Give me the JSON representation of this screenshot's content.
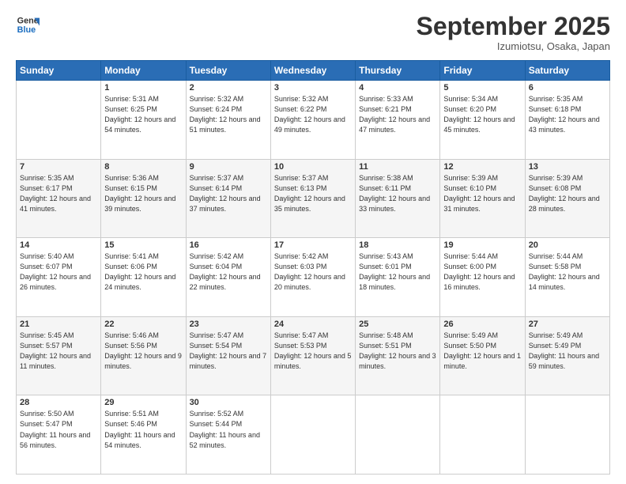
{
  "logo": {
    "line1": "General",
    "line2": "Blue"
  },
  "header": {
    "month": "September 2025",
    "location": "Izumiotsu, Osaka, Japan"
  },
  "weekdays": [
    "Sunday",
    "Monday",
    "Tuesday",
    "Wednesday",
    "Thursday",
    "Friday",
    "Saturday"
  ],
  "weeks": [
    [
      {
        "day": "",
        "sunrise": "",
        "sunset": "",
        "daylight": ""
      },
      {
        "day": "1",
        "sunrise": "5:31 AM",
        "sunset": "6:25 PM",
        "daylight": "12 hours and 54 minutes."
      },
      {
        "day": "2",
        "sunrise": "5:32 AM",
        "sunset": "6:24 PM",
        "daylight": "12 hours and 51 minutes."
      },
      {
        "day": "3",
        "sunrise": "5:32 AM",
        "sunset": "6:22 PM",
        "daylight": "12 hours and 49 minutes."
      },
      {
        "day": "4",
        "sunrise": "5:33 AM",
        "sunset": "6:21 PM",
        "daylight": "12 hours and 47 minutes."
      },
      {
        "day": "5",
        "sunrise": "5:34 AM",
        "sunset": "6:20 PM",
        "daylight": "12 hours and 45 minutes."
      },
      {
        "day": "6",
        "sunrise": "5:35 AM",
        "sunset": "6:18 PM",
        "daylight": "12 hours and 43 minutes."
      }
    ],
    [
      {
        "day": "7",
        "sunrise": "5:35 AM",
        "sunset": "6:17 PM",
        "daylight": "12 hours and 41 minutes."
      },
      {
        "day": "8",
        "sunrise": "5:36 AM",
        "sunset": "6:15 PM",
        "daylight": "12 hours and 39 minutes."
      },
      {
        "day": "9",
        "sunrise": "5:37 AM",
        "sunset": "6:14 PM",
        "daylight": "12 hours and 37 minutes."
      },
      {
        "day": "10",
        "sunrise": "5:37 AM",
        "sunset": "6:13 PM",
        "daylight": "12 hours and 35 minutes."
      },
      {
        "day": "11",
        "sunrise": "5:38 AM",
        "sunset": "6:11 PM",
        "daylight": "12 hours and 33 minutes."
      },
      {
        "day": "12",
        "sunrise": "5:39 AM",
        "sunset": "6:10 PM",
        "daylight": "12 hours and 31 minutes."
      },
      {
        "day": "13",
        "sunrise": "5:39 AM",
        "sunset": "6:08 PM",
        "daylight": "12 hours and 28 minutes."
      }
    ],
    [
      {
        "day": "14",
        "sunrise": "5:40 AM",
        "sunset": "6:07 PM",
        "daylight": "12 hours and 26 minutes."
      },
      {
        "day": "15",
        "sunrise": "5:41 AM",
        "sunset": "6:06 PM",
        "daylight": "12 hours and 24 minutes."
      },
      {
        "day": "16",
        "sunrise": "5:42 AM",
        "sunset": "6:04 PM",
        "daylight": "12 hours and 22 minutes."
      },
      {
        "day": "17",
        "sunrise": "5:42 AM",
        "sunset": "6:03 PM",
        "daylight": "12 hours and 20 minutes."
      },
      {
        "day": "18",
        "sunrise": "5:43 AM",
        "sunset": "6:01 PM",
        "daylight": "12 hours and 18 minutes."
      },
      {
        "day": "19",
        "sunrise": "5:44 AM",
        "sunset": "6:00 PM",
        "daylight": "12 hours and 16 minutes."
      },
      {
        "day": "20",
        "sunrise": "5:44 AM",
        "sunset": "5:58 PM",
        "daylight": "12 hours and 14 minutes."
      }
    ],
    [
      {
        "day": "21",
        "sunrise": "5:45 AM",
        "sunset": "5:57 PM",
        "daylight": "12 hours and 11 minutes."
      },
      {
        "day": "22",
        "sunrise": "5:46 AM",
        "sunset": "5:56 PM",
        "daylight": "12 hours and 9 minutes."
      },
      {
        "day": "23",
        "sunrise": "5:47 AM",
        "sunset": "5:54 PM",
        "daylight": "12 hours and 7 minutes."
      },
      {
        "day": "24",
        "sunrise": "5:47 AM",
        "sunset": "5:53 PM",
        "daylight": "12 hours and 5 minutes."
      },
      {
        "day": "25",
        "sunrise": "5:48 AM",
        "sunset": "5:51 PM",
        "daylight": "12 hours and 3 minutes."
      },
      {
        "day": "26",
        "sunrise": "5:49 AM",
        "sunset": "5:50 PM",
        "daylight": "12 hours and 1 minute."
      },
      {
        "day": "27",
        "sunrise": "5:49 AM",
        "sunset": "5:49 PM",
        "daylight": "11 hours and 59 minutes."
      }
    ],
    [
      {
        "day": "28",
        "sunrise": "5:50 AM",
        "sunset": "5:47 PM",
        "daylight": "11 hours and 56 minutes."
      },
      {
        "day": "29",
        "sunrise": "5:51 AM",
        "sunset": "5:46 PM",
        "daylight": "11 hours and 54 minutes."
      },
      {
        "day": "30",
        "sunrise": "5:52 AM",
        "sunset": "5:44 PM",
        "daylight": "11 hours and 52 minutes."
      },
      {
        "day": "",
        "sunrise": "",
        "sunset": "",
        "daylight": ""
      },
      {
        "day": "",
        "sunrise": "",
        "sunset": "",
        "daylight": ""
      },
      {
        "day": "",
        "sunrise": "",
        "sunset": "",
        "daylight": ""
      },
      {
        "day": "",
        "sunrise": "",
        "sunset": "",
        "daylight": ""
      }
    ]
  ]
}
